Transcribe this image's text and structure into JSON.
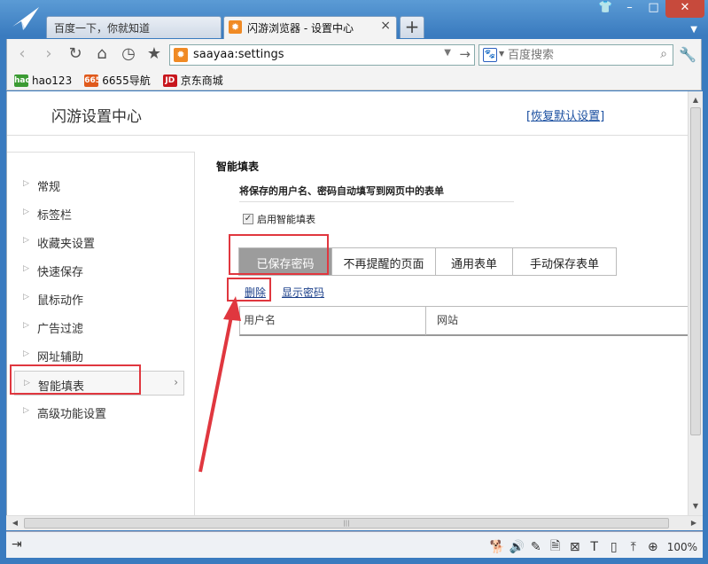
{
  "tabs": [
    {
      "label": "百度一下，你就知道",
      "active": false
    },
    {
      "label": "闪游浏览器 - 设置中心",
      "active": true
    }
  ],
  "toolbar": {
    "address": "saayaa:settings",
    "search_placeholder": "百度搜索"
  },
  "bookmarks": [
    {
      "label": "hao123",
      "icon": "hao"
    },
    {
      "label": "6655导航",
      "icon": "6655"
    },
    {
      "label": "京东商城",
      "icon": "JD"
    }
  ],
  "page": {
    "title": "闪游设置中心",
    "restore_link": "[恢复默认设置]"
  },
  "sidebar": {
    "items": [
      {
        "label": "常规"
      },
      {
        "label": "标签栏"
      },
      {
        "label": "收藏夹设置"
      },
      {
        "label": "快速保存"
      },
      {
        "label": "鼠标动作"
      },
      {
        "label": "广告过滤"
      },
      {
        "label": "网址辅助"
      },
      {
        "label": "智能填表",
        "selected": true
      },
      {
        "label": "高级功能设置"
      }
    ]
  },
  "autofill": {
    "section_title": "智能填表",
    "description": "将保存的用户名、密码自动填写到网页中的表单",
    "enable_label": "启用智能填表",
    "enable_checked": true,
    "tabs": [
      {
        "label": "已保存密码",
        "active": true
      },
      {
        "label": "不再提醒的页面"
      },
      {
        "label": "通用表单"
      },
      {
        "label": "手动保存表单"
      }
    ],
    "delete_label": "删除",
    "show_password_label": "显示密码",
    "columns": [
      "用户名",
      "网站"
    ]
  },
  "status": {
    "zoom": "100%"
  },
  "colors": {
    "highlight": "#e0373f",
    "window_frame": "#3a7bbf",
    "active_tab_bg": "#9c9c9c"
  }
}
